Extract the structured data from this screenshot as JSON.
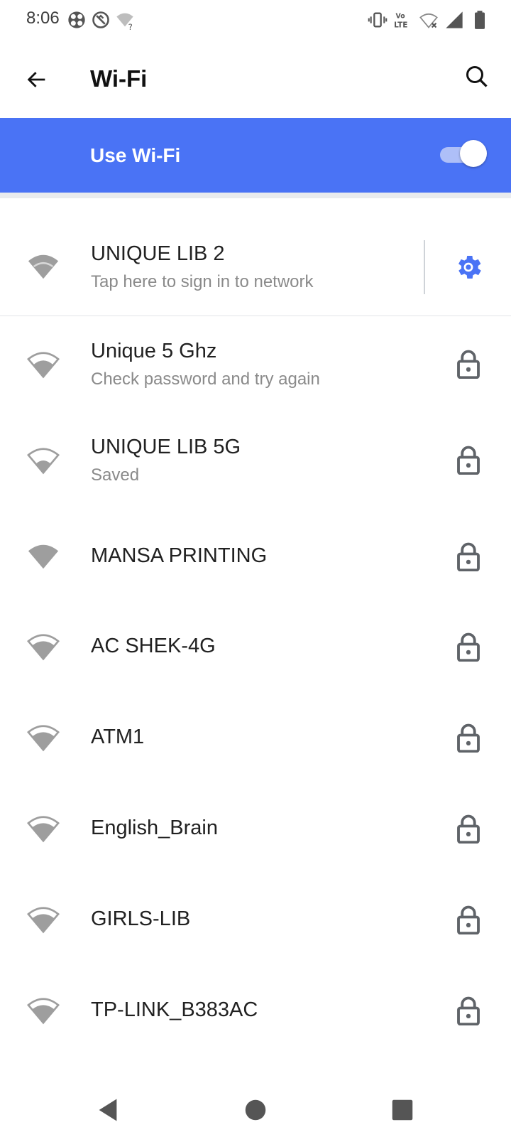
{
  "status_bar": {
    "time": "8:06",
    "left_icons": [
      "app-notification-icon",
      "sync-off-icon",
      "wifi-question-icon"
    ],
    "right_icons": [
      "vibrate-icon",
      "volte-icon",
      "wifi-off-icon",
      "cell-signal-icon",
      "battery-icon"
    ]
  },
  "app_bar": {
    "title": "Wi-Fi"
  },
  "wifi_toggle": {
    "label": "Use Wi-Fi",
    "enabled": true
  },
  "colors": {
    "accent": "#4a73f5",
    "wifi_icon": "#9e9e9e",
    "subtitle": "#8a8a8a",
    "lock": "#5f6368"
  },
  "networks": [
    {
      "name": "UNIQUE LIB 2",
      "status": "Tap here to sign in to network",
      "connected": true,
      "action_icon": "settings-gear-icon"
    },
    {
      "name": "Unique 5 Ghz",
      "status": "Check password and try again",
      "secured": true,
      "action_icon": "lock-icon"
    },
    {
      "name": "UNIQUE LIB 5G",
      "status": "Saved",
      "secured": true,
      "action_icon": "lock-icon"
    },
    {
      "name": "MANSA PRINTING",
      "secured": true,
      "action_icon": "lock-icon"
    },
    {
      "name": "AC SHEK-4G",
      "secured": true,
      "action_icon": "lock-icon"
    },
    {
      "name": "ATM1",
      "secured": true,
      "action_icon": "lock-icon"
    },
    {
      "name": "English_Brain",
      "secured": true,
      "action_icon": "lock-icon"
    },
    {
      "name": "GIRLS-LIB",
      "secured": true,
      "action_icon": "lock-icon"
    },
    {
      "name": "TP-LINK_B383AC",
      "secured": true,
      "action_icon": "lock-icon"
    }
  ],
  "nav_bar": {
    "buttons": [
      "back-triangle-icon",
      "home-circle-icon",
      "recents-square-icon"
    ]
  }
}
